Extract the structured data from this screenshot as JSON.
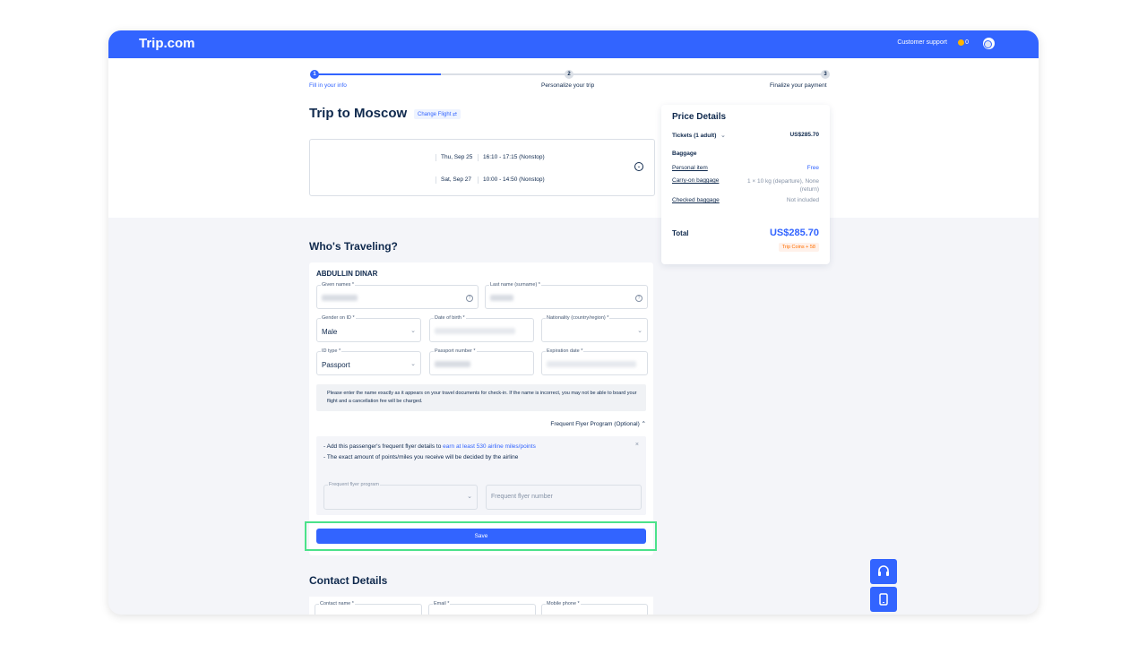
{
  "header": {
    "logo": "Trip.com",
    "support": "Customer support",
    "coins": "0"
  },
  "steps": [
    {
      "num": "1",
      "label": "Fill in your info"
    },
    {
      "num": "2",
      "label": "Personalize your trip"
    },
    {
      "num": "3",
      "label": "Finalize your payment"
    }
  ],
  "trip": {
    "title": "Trip to Moscow",
    "change_flight": "Change Flight ⇄"
  },
  "flights": [
    {
      "date": "Thu, Sep 25",
      "time": "16:10 - 17:15 (Nonstop)"
    },
    {
      "date": "Sat, Sep 27",
      "time": "10:00 - 14:50 (Nonstop)"
    }
  ],
  "price": {
    "title": "Price Details",
    "tickets_label": "Tickets  (1 adult)",
    "tickets_value": "US$285.70",
    "baggage_heading": "Baggage",
    "personal_item": "Personal item",
    "personal_item_value": "Free",
    "carry_on": "Carry-on baggage",
    "carry_on_value": "1 × 10 kg (departure), None (return)",
    "checked": "Checked baggage",
    "checked_value": "Not included",
    "total_label": "Total",
    "total_value": "US$285.70",
    "trip_coins": "Trip Coins + 58"
  },
  "travelers": {
    "heading": "Who's Traveling?",
    "name": "ABDULLIN DINAR",
    "given_names_label": "Given names *",
    "last_name_label": "Last name (surname) *",
    "gender_label": "Gender on ID *",
    "gender_value": "Male",
    "dob_label": "Date of birth *",
    "nationality_label": "Nationality (country/region) *",
    "id_type_label": "ID type *",
    "id_type_value": "Passport",
    "passport_label": "Passport number *",
    "expiration_label": "Expiration date *",
    "notice": "Please enter the name exactly as it appears on your travel documents for check-in. If the name is incorrect, you may not be able to board your flight and a cancellation fee will be charged.",
    "ffp_toggle": "Frequent Flyer Program (Optional)",
    "ffp_line1_prefix": "- Add this passenger's frequent flyer details to ",
    "ffp_line1_link": "earn at least 530 airline miles/points",
    "ffp_line2": "- The exact amount of points/miles you receive will be decided by the airline",
    "ffp_program_label": "Frequent flyer program",
    "ffp_number_placeholder": "Frequent flyer number",
    "save": "Save"
  },
  "contact": {
    "heading": "Contact Details",
    "name_label": "Contact name *",
    "email_label": "Email *",
    "phone_label": "Mobile phone *"
  }
}
